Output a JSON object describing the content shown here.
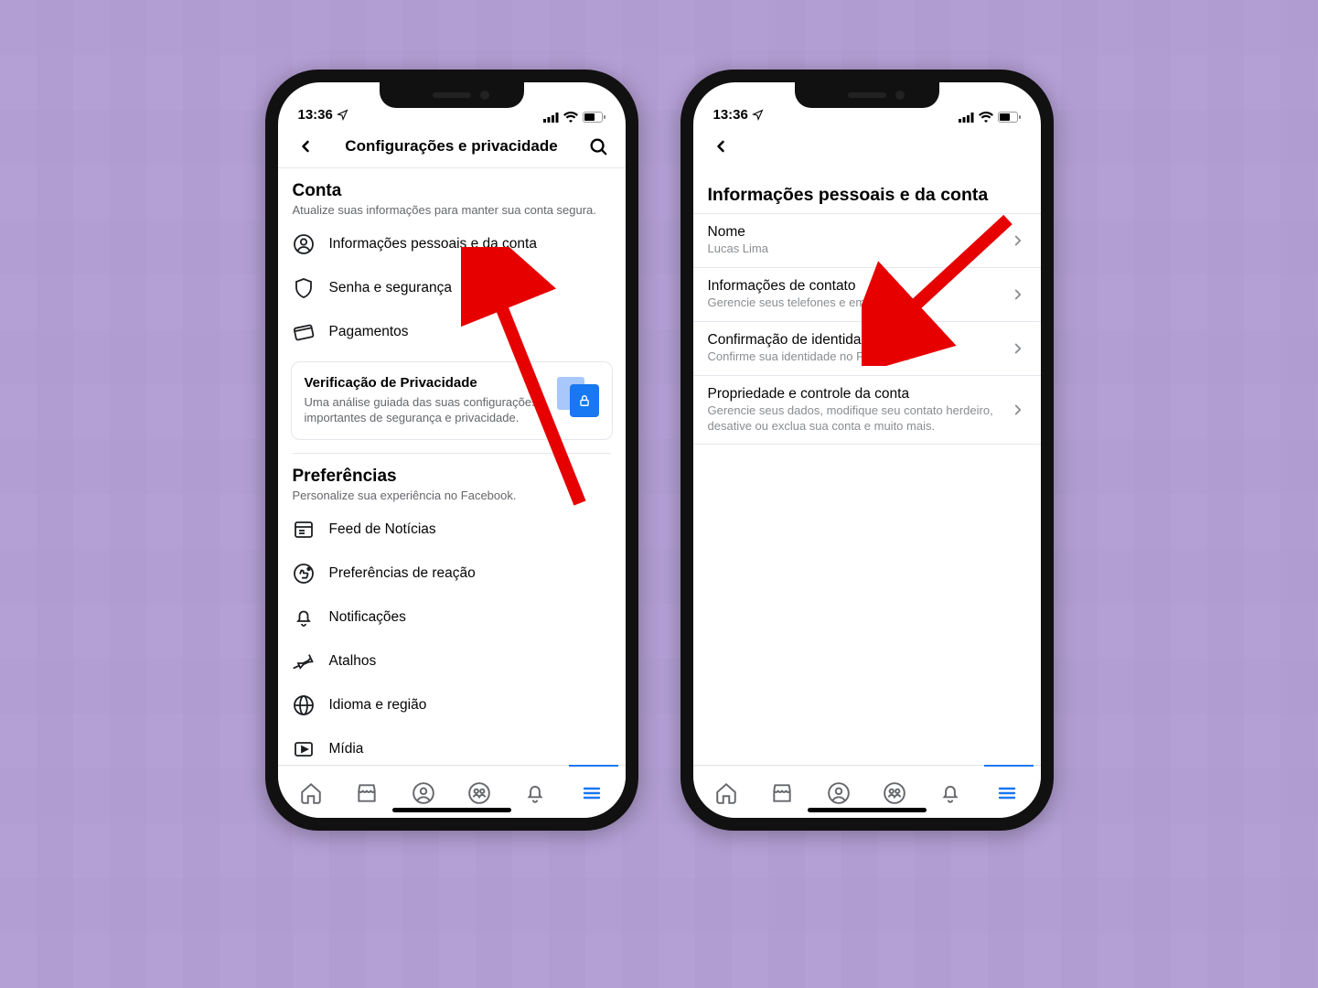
{
  "status": {
    "time": "13:36"
  },
  "left": {
    "header_title": "Configurações e privacidade",
    "section_account": {
      "title": "Conta",
      "subtitle": "Atualize suas informações para manter sua conta segura."
    },
    "rows": {
      "personal_info": "Informações pessoais e da conta",
      "password_security": "Senha e segurança",
      "payments": "Pagamentos"
    },
    "privacy_card": {
      "title": "Verificação de Privacidade",
      "desc": "Uma análise guiada das suas configurações importantes de segurança e privacidade."
    },
    "section_prefs": {
      "title": "Preferências",
      "subtitle": "Personalize sua experiência no Facebook."
    },
    "pref_rows": {
      "feed": "Feed de Notícias",
      "reactions": "Preferências de reação",
      "notifications": "Notificações",
      "shortcuts": "Atalhos",
      "language": "Idioma e região",
      "media": "Mídia"
    }
  },
  "right": {
    "page_title": "Informações pessoais e da conta",
    "rows": {
      "name": {
        "title": "Nome",
        "sub": "Lucas Lima"
      },
      "contact": {
        "title": "Informações de contato",
        "sub": "Gerencie seus telefones e emails"
      },
      "identity": {
        "title": "Confirmação de identidade",
        "sub": "Confirme sua identidade no Facebook"
      },
      "ownership": {
        "title": "Propriedade e controle da conta",
        "sub": "Gerencie seus dados, modifique seu contato herdeiro, desative ou exclua sua conta e muito mais."
      }
    }
  }
}
